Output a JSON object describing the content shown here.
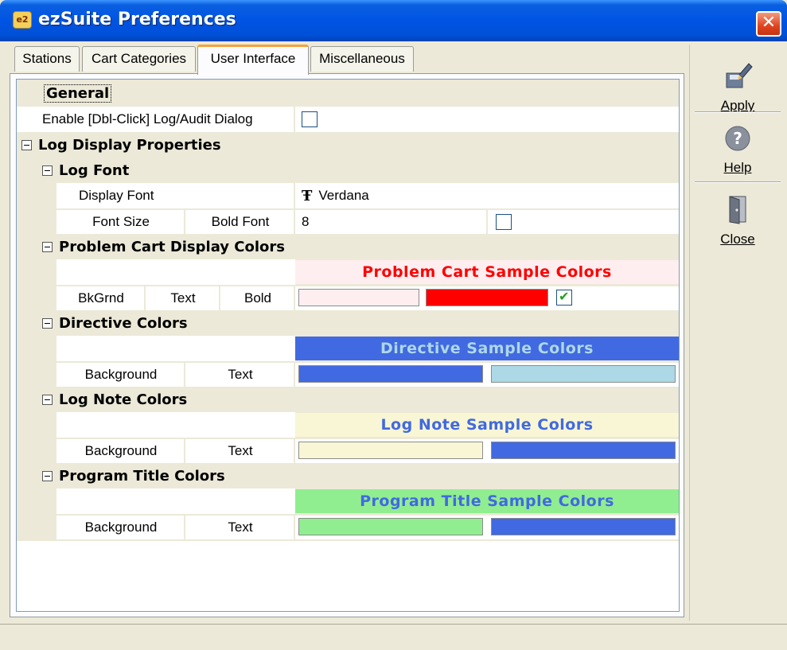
{
  "window": {
    "title": "ezSuite Preferences",
    "icon_text": "e2",
    "close_glyph": "✕"
  },
  "tabs": [
    {
      "label": "Stations",
      "active": false
    },
    {
      "label": "Cart Categories",
      "active": false
    },
    {
      "label": "User Interface",
      "active": true
    },
    {
      "label": "Miscellaneous",
      "active": false
    }
  ],
  "toolbar": {
    "apply_label": "Apply",
    "help_label": "Help",
    "close_label": "Close"
  },
  "grid": {
    "general": {
      "label": "General",
      "enable_dblclick_label": "Enable [Dbl-Click] Log/Audit Dialog",
      "enable_dblclick_checked": false
    },
    "log_display": {
      "label": "Log Display Properties",
      "log_font": {
        "label": "Log Font",
        "display_font_label": "Display Font",
        "display_font_value": "Verdana",
        "font_size_label": "Font Size",
        "font_size_value": "8",
        "bold_font_label": "Bold Font",
        "bold_font_checked": false
      },
      "problem_cart": {
        "label": "Problem Cart Display Colors",
        "sample_text": "Problem Cart Sample Colors",
        "bkgrnd_label": "BkGrnd",
        "text_label": "Text",
        "bold_label": "Bold",
        "bold_checked": true,
        "background_color": "#ffeef0",
        "text_color": "#ff0000"
      },
      "directive": {
        "label": "Directive Colors",
        "sample_text": "Directive Sample Colors",
        "background_label": "Background",
        "text_label": "Text",
        "background_color": "#4169e1",
        "text_color": "#add8e6"
      },
      "log_note": {
        "label": "Log Note Colors",
        "sample_text": "Log Note Sample Colors",
        "background_label": "Background",
        "text_label": "Text",
        "background_color": "#f8f6d4",
        "text_color": "#4169e1"
      },
      "program_title": {
        "label": "Program Title Colors",
        "sample_text": "Program Title Sample Colors",
        "background_label": "Background",
        "text_label": "Text",
        "background_color": "#90ee90",
        "text_color": "#4169e1"
      }
    }
  }
}
